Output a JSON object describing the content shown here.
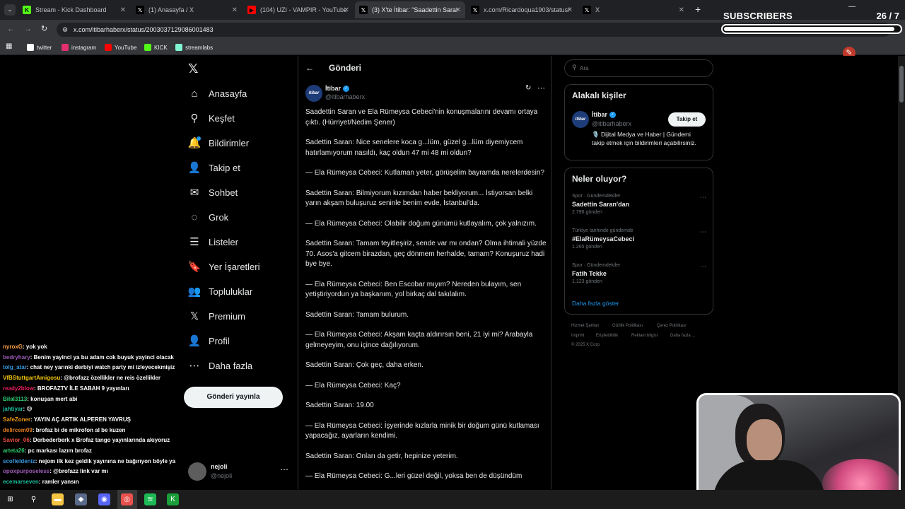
{
  "browser": {
    "tabs": [
      {
        "label": "Stream - Kick Dashboard",
        "icon": "kick-icon",
        "color": "#53fc18"
      },
      {
        "label": "(1) Anasayfa / X",
        "icon": "x-icon",
        "color": "#ffffff"
      },
      {
        "label": "(104) UZI - VAMPIR - YouTube",
        "icon": "youtube-icon",
        "color": "#ff0000"
      },
      {
        "label": "(3) X'te İtibar: \"Saadettin Saran",
        "icon": "x-icon",
        "color": "#ffffff"
      },
      {
        "label": "x.com/Ricardoqua1903/status/",
        "icon": "x-icon",
        "color": "#ffffff"
      },
      {
        "label": "X",
        "icon": "x-icon",
        "color": "#ffffff"
      }
    ],
    "url": "x.com/itibarhaberx/status/2003037129086001483",
    "bookmarks": [
      {
        "label": "twitter",
        "icon": "x-icon",
        "color": "#ffffff"
      },
      {
        "label": "instagram",
        "icon": "instagram-icon",
        "color": "#e1306c"
      },
      {
        "label": "YouTube",
        "icon": "youtube-icon",
        "color": "#ff0000"
      },
      {
        "label": "KICK",
        "icon": "kick-icon",
        "color": "#53fc18"
      },
      {
        "label": "streamlabs",
        "icon": "streamlabs-icon",
        "color": "#80f5d2"
      }
    ]
  },
  "overlay": {
    "subs_label": "SUBSCRIBERS",
    "subs_count": "26 / 7",
    "subs_fraction": 0.97
  },
  "x": {
    "nav": [
      {
        "label": "Anasayfa",
        "icon": "home-icon",
        "glyph": "⌂"
      },
      {
        "label": "Keşfet",
        "icon": "search-icon",
        "glyph": "⚲"
      },
      {
        "label": "Bildirimler",
        "icon": "bell-icon",
        "glyph": "🔔"
      },
      {
        "label": "Takip et",
        "icon": "add-person-icon",
        "glyph": "👤"
      },
      {
        "label": "Sohbet",
        "icon": "envelope-icon",
        "glyph": "✉"
      },
      {
        "label": "Grok",
        "icon": "grok-icon",
        "glyph": "◌"
      },
      {
        "label": "Listeler",
        "icon": "list-icon",
        "glyph": "☰"
      },
      {
        "label": "Yer İşaretleri",
        "icon": "bookmark-icon",
        "glyph": "🔖"
      },
      {
        "label": "Topluluklar",
        "icon": "communities-icon",
        "glyph": "👥"
      },
      {
        "label": "Premium",
        "icon": "x-logo-icon",
        "glyph": "𝕏"
      },
      {
        "label": "Profil",
        "icon": "profile-icon",
        "glyph": "👤"
      },
      {
        "label": "Daha fazla",
        "icon": "more-circle-icon",
        "glyph": "⋯"
      }
    ],
    "post_button": "Gönderi yayınla",
    "account": {
      "name": "nejoli",
      "handle": "@nejoli"
    },
    "header_title": "Gönderi",
    "author": {
      "name": "İtibar",
      "handle": "@itibarhaberx",
      "avatar_text": "itibar"
    },
    "post_paragraphs": [
      "Saadettin Saran ve Ela Rümeysa Cebeci'nin konuşmalarını devamı ortaya çıktı. (Hürriyet/Nedim Şener)",
      "Sadettin Saran: Nice senelere koca g...lüm, güzel g...lüm diyemiycem hatırlamıyorum nasıldı, kaç oldun 47 mi 48 mi oldun?",
      "— Ela Rümeysa Cebeci: Kutlaman yeter, görüşelim bayramda nerelerdesin?",
      "Sadettin Saran: Bilmiyorum kızımdan haber bekliyorum... İstiyorsan belki yarın akşam buluşuruz seninle benim evde, İstanbul'da.",
      "— Ela Rümeysa Cebeci: Olabilir doğum günümü kutlayalım, çok yalnızım.",
      "Sadettin Saran: Tamam teyitleşiriz, sende var mı ondan? Olma ihtimali yüzde 70. Asos'a gitcem birazdan, geç dönmem herhalde, tamam? Konuşuruz hadi bye bye.",
      "— Ela Rümeysa Cebeci: Ben Escobar mıyım? Nereden bulayım, sen yetiştiriyordun ya başkanım, yol birkaç dal takılalım.",
      "Sadettin Saran: Tamam bulurum.",
      "— Ela Rümeysa Cebeci: Akşam kaçta aldırırsın beni, 21 iyi mi? Arabayla gelmeyeyim, onu içince dağılıyorum.",
      "Sadettin Saran: Çok geç, daha erken.",
      "— Ela Rümeysa Cebeci: Kaç?",
      "Sadettin Saran: 19.00",
      "— Ela Rümeysa Cebeci: İşyerinde kızlarla minik bir doğum günü kutlaması yapacağız, ayarların kendimi.",
      "Sadettin Saran: Onları da getir, hepinize yeterim.",
      "— Ela Rümeysa Cebeci: G...leri güzel değil, yoksa ben de düşündüm"
    ],
    "search_placeholder": "Ara",
    "related": {
      "title": "Alakalı kişiler",
      "name": "İtibar",
      "handle": "@itibarhaberx",
      "bio": "🎙️ Dijital Medya ve Haber | Gündemi takip etmek için bildirimleri açabilirsiniz.",
      "follow_label": "Takip et"
    },
    "trends": {
      "title": "Neler oluyor?",
      "items": [
        {
          "context": "Spor · Gündemdekiler",
          "topic": "Sadettin Saran'dan",
          "posts": "2.796 gönderi"
        },
        {
          "context": "Türkiye tarihinde gündemde",
          "topic": "#ElaRümeysaCebeci",
          "posts": "1.265 gönderi"
        },
        {
          "context": "Spor · Gündemdekiler",
          "topic": "Fatih Tekke",
          "posts": "1.123 gönderi"
        }
      ],
      "more": "Daha fazla göster"
    },
    "footer": [
      "Hizmet Şartları",
      "Gizlilik Politikası",
      "Çerez Politikası",
      "Imprint",
      "Erişilebilirlik",
      "Reklam bilgisi",
      "Daha fazla ...",
      "© 2025 X Corp."
    ]
  },
  "chat": [
    {
      "user": "nyroxG",
      "msg": ": yok yok",
      "color": "#ff9f43"
    },
    {
      "user": "bedryhary",
      "msg": ": Benim yayinci ya bu adam cok buyuk yayinci olacak",
      "color": "#9b59b6"
    },
    {
      "user": "tolg_atar",
      "msg": ": chat ney yarınki derbiyi watch party mi izleyecekmişiz",
      "color": "#3498db"
    },
    {
      "user": "VfBStuttgartAmigosu",
      "msg": ": @brofazz özellikler ne reis özellikler",
      "color": "#f1c40f"
    },
    {
      "user": "ready2blow",
      "msg": ": BROFAZTV İLE SABAH 9 yayınları",
      "color": "#e91e63"
    },
    {
      "user": "Bilal3113",
      "msg": ": konuşan mert abi",
      "color": "#2ecc71"
    },
    {
      "user": "jahtiyar",
      "msg": ": 😅",
      "color": "#1abc9c"
    },
    {
      "user": "SafeZoner",
      "msg": ": YAYIN AÇ ARTIK ALPEREN YAVRUŞ",
      "color": "#f39c12"
    },
    {
      "user": "delircem09",
      "msg": ": brofaz bi de mikrofon al be kuzen",
      "color": "#e67e22"
    },
    {
      "user": "Savior_06",
      "msg": ": Derbederberk x Brofaz tango yayınlarında akıyoruz",
      "color": "#e74c3c"
    },
    {
      "user": "arteta26",
      "msg": ": pc markası lazım brofaz",
      "color": "#2ecc71"
    },
    {
      "user": "scofieldeniz",
      "msg": ": nejom ilk kez geldik yayınına ne bağırıyon böyle ya",
      "color": "#3498db"
    },
    {
      "user": "opoxpurposeless",
      "msg": ": @brofazz link var mı",
      "color": "#9b59b6"
    },
    {
      "user": "ecemarseven",
      "msg": ": ramler yansın",
      "color": "#1abc9c"
    }
  ],
  "taskbar": [
    {
      "icon": "windows-start-icon",
      "glyph": "⊞",
      "color": "#1c1c1c"
    },
    {
      "icon": "search-icon",
      "glyph": "⚲",
      "color": "#1c1c1c"
    },
    {
      "icon": "file-explorer-icon",
      "glyph": "▬",
      "color": "#f4c542"
    },
    {
      "icon": "app-icon",
      "glyph": "◆",
      "color": "#5a6a8a"
    },
    {
      "icon": "discord-icon",
      "glyph": "◉",
      "color": "#5865f2"
    },
    {
      "icon": "chrome-icon",
      "glyph": "◎",
      "color": "#e53935"
    },
    {
      "icon": "spotify-icon",
      "glyph": "≋",
      "color": "#1db954"
    },
    {
      "icon": "kick-icon",
      "glyph": "K",
      "color": "#1a9e3a"
    }
  ]
}
